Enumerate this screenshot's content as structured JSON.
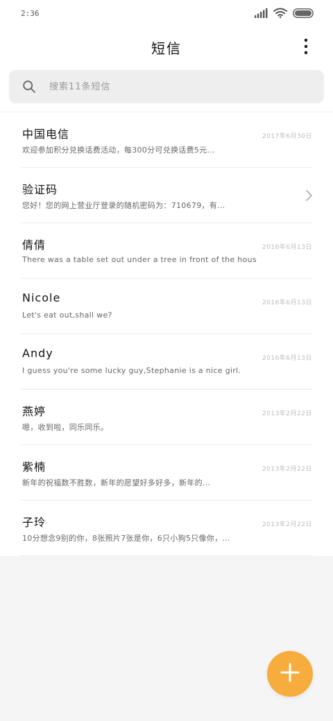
{
  "status_bar": {
    "time": "2:36"
  },
  "header": {
    "title": "短信",
    "more_icon": "more-vertical-icon"
  },
  "search": {
    "placeholder": "搜索11条短信",
    "icon": "search-icon"
  },
  "conversations": [
    {
      "name": "中国电信",
      "date": "2017年6月30日",
      "preview": "欢迎参加积分兑换话费活动，每300分可兑换话费5元..."
    },
    {
      "name": "验证码",
      "date": "",
      "preview": "您好！您的网上营业厅登录的随机密码为：710679，有..."
    },
    {
      "name": "倩倩",
      "date": "2016年6月13日",
      "preview": "There was a table set out under a tree in front of the hous"
    },
    {
      "name": "Nicole",
      "date": "2016年6月13日",
      "preview": "Let's eat out,shall we?"
    },
    {
      "name": "Andy",
      "date": "2016年6月13日",
      "preview": "I guess you're some lucky guy,Stephanie is a nice girl."
    },
    {
      "name": "燕婷",
      "date": "2013年2月22日",
      "preview": "嗯，收到啦，同乐同乐。"
    },
    {
      "name": "紫楠",
      "date": "2013年2月22日",
      "preview": "新年的祝福数不胜数，新年的愿望好多好多，新年的..."
    },
    {
      "name": "子玲",
      "date": "2013年2月22日",
      "preview": "10分想念9别的你，8张照片7张是你，6只小狗5只像你，..."
    }
  ],
  "fab": {
    "icon": "plus-icon"
  },
  "colors": {
    "accent": "#f6ad3d",
    "background": "#f5f5f5",
    "search_bg": "#eeeeee"
  }
}
